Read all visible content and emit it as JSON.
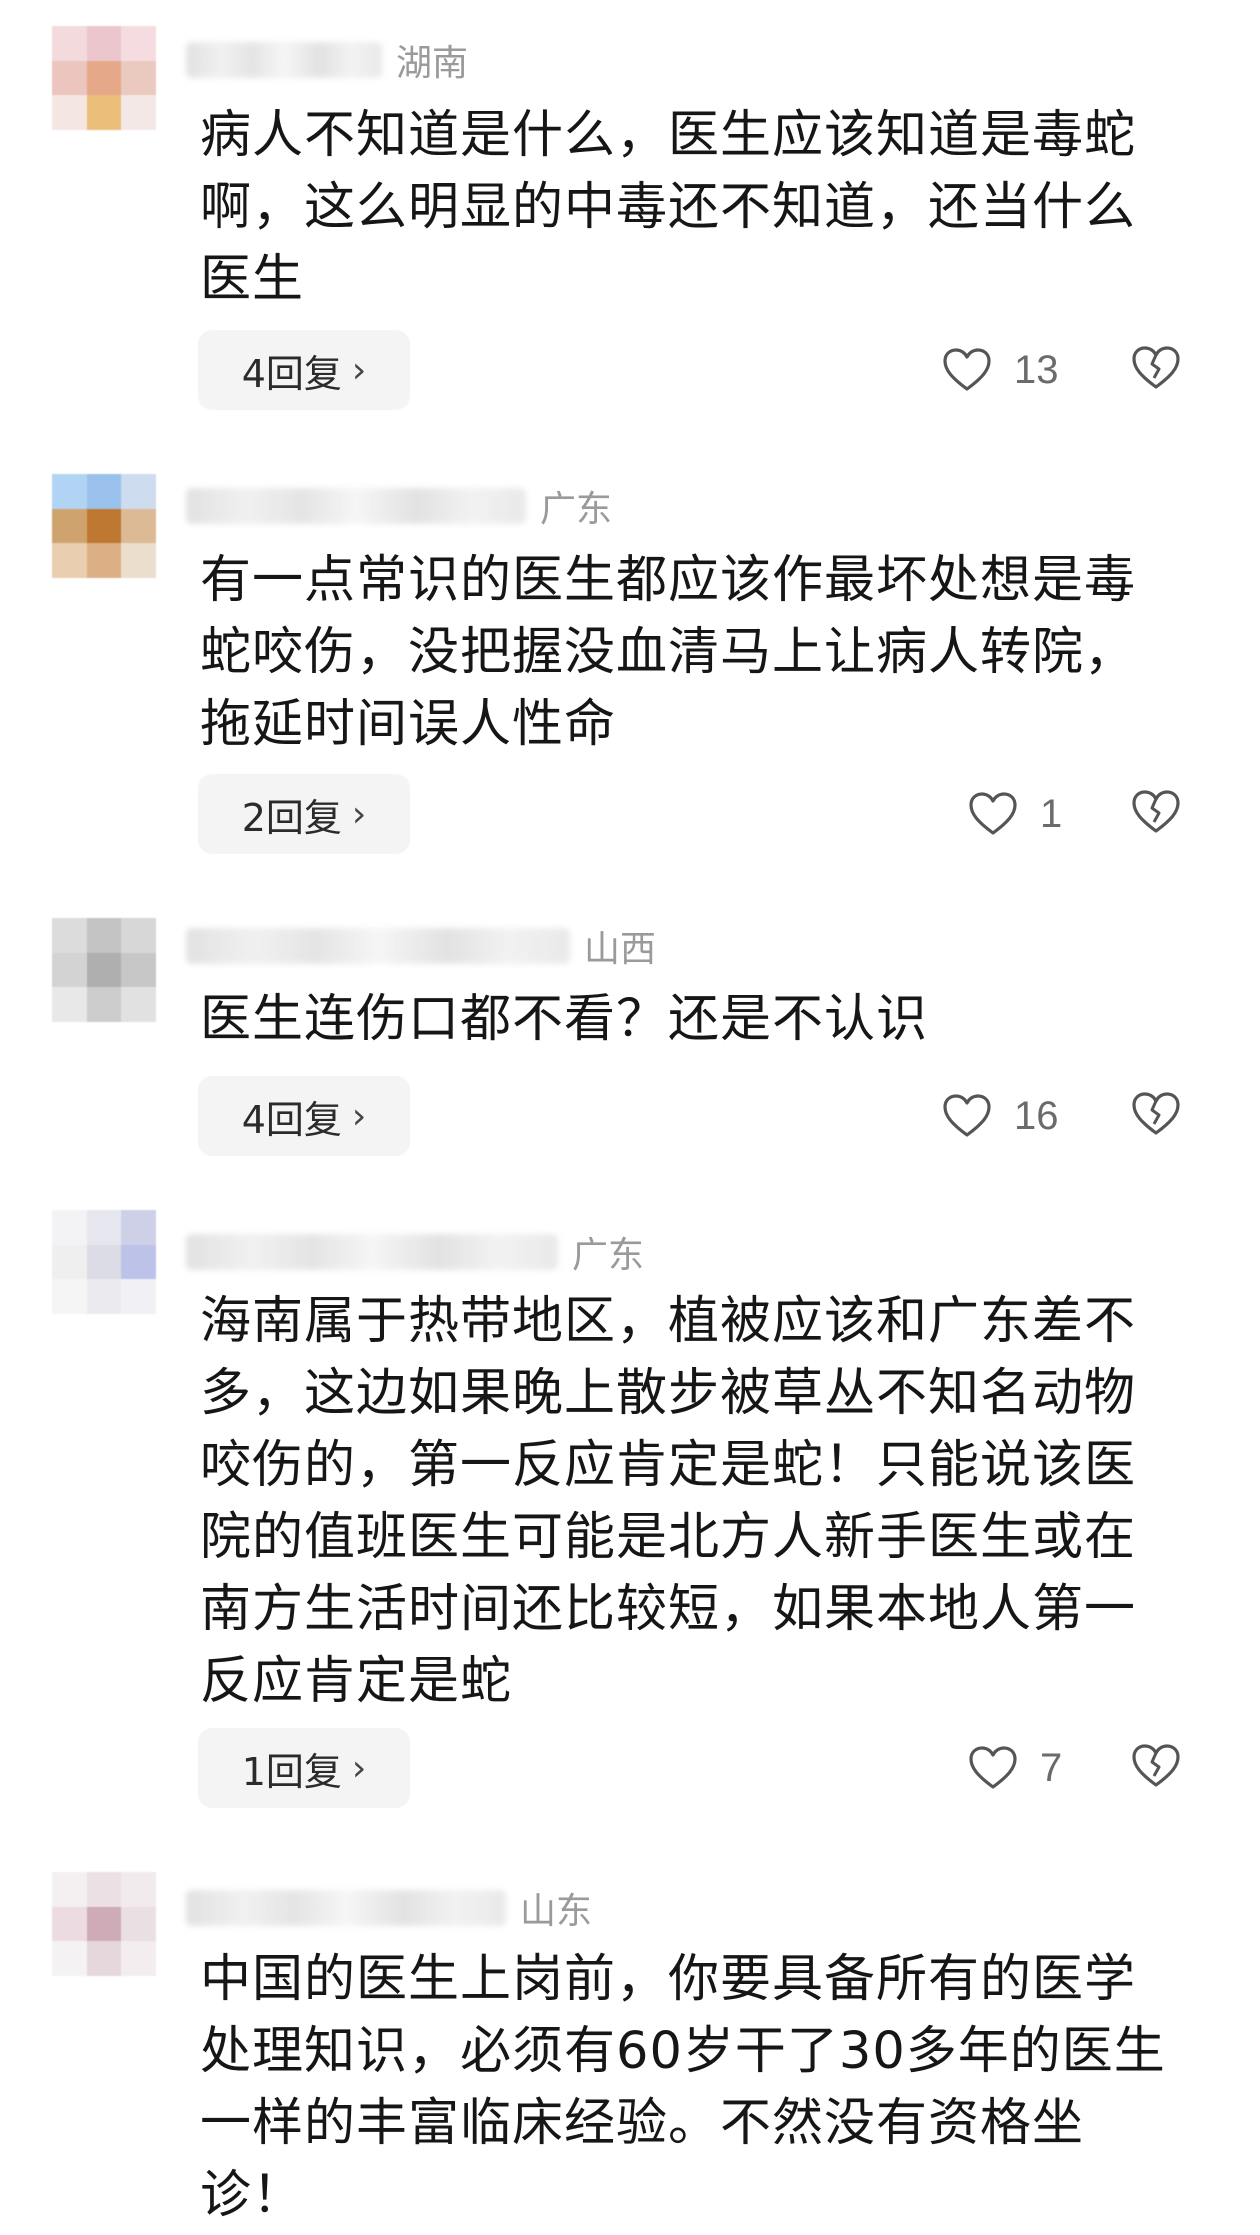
{
  "comments": [
    {
      "region": "湖南",
      "text": "病人不知道是什么，医生应该知道是毒蛇啊，这么明显的中毒还不知道，还当什么医生",
      "replies_label": "4回复",
      "likes": "13",
      "avatar_colors": [
        "#f1d6da",
        "#e9c2c8",
        "#f3d9dd",
        "#eac0b8",
        "#e3a07e",
        "#e8c4b8",
        "#f3e4e1",
        "#e9b86b",
        "#f2e6e3"
      ]
    },
    {
      "region": "广东",
      "text": "有一点常识的医生都应该作最坏处想是毒蛇咬伤，没把握没血清马上让病人转院，拖延时间误人性命",
      "replies_label": "2回复",
      "likes": "1",
      "avatar_colors": [
        "#a9cff3",
        "#8fbbe9",
        "#c9d9ee",
        "#c99a5f",
        "#b86a1c",
        "#d8b38a",
        "#e7c9a8",
        "#d9a877",
        "#eadbc8"
      ]
    },
    {
      "region": "山西",
      "text": "医生连伤口都不看？还是不认识",
      "replies_label": "4回复",
      "likes": "16",
      "avatar_colors": [
        "#d9d9d9",
        "#bdbdbd",
        "#d3d3d3",
        "#cfcfcf",
        "#a7a7a7",
        "#c2c2c2",
        "#e6e6e6",
        "#c8c8c8",
        "#dedede"
      ]
    },
    {
      "region": "广东",
      "text": "海南属于热带地区，植被应该和广东差不多，这边如果晚上散步被草丛不知名动物咬伤的，第一反应肯定是蛇！只能说该医院的值班医生可能是北方人新手医生或在南方生活时间还比较短，如果本地人第一反应肯定是蛇",
      "replies_label": "1回复",
      "likes": "7",
      "avatar_colors": [
        "#f2f2f5",
        "#e4e4ee",
        "#c9cbe6",
        "#eeeeee",
        "#d8d9e4",
        "#b6bde6",
        "#f4f4f4",
        "#e9e9ee",
        "#f0f0f4"
      ]
    },
    {
      "region": "山东",
      "text": "中国的医生上岗前，你要具备所有的医学处理知识，必须有60岁干了30多年的医生一样的丰富临床经验。不然没有资格坐诊！",
      "avatar_colors": [
        "#f3eef0",
        "#e9dde2",
        "#f1e9ec",
        "#ead9df",
        "#c9a3b0",
        "#e8dde1",
        "#f5f1f3",
        "#e3d3d9",
        "#f2ecee"
      ]
    }
  ]
}
